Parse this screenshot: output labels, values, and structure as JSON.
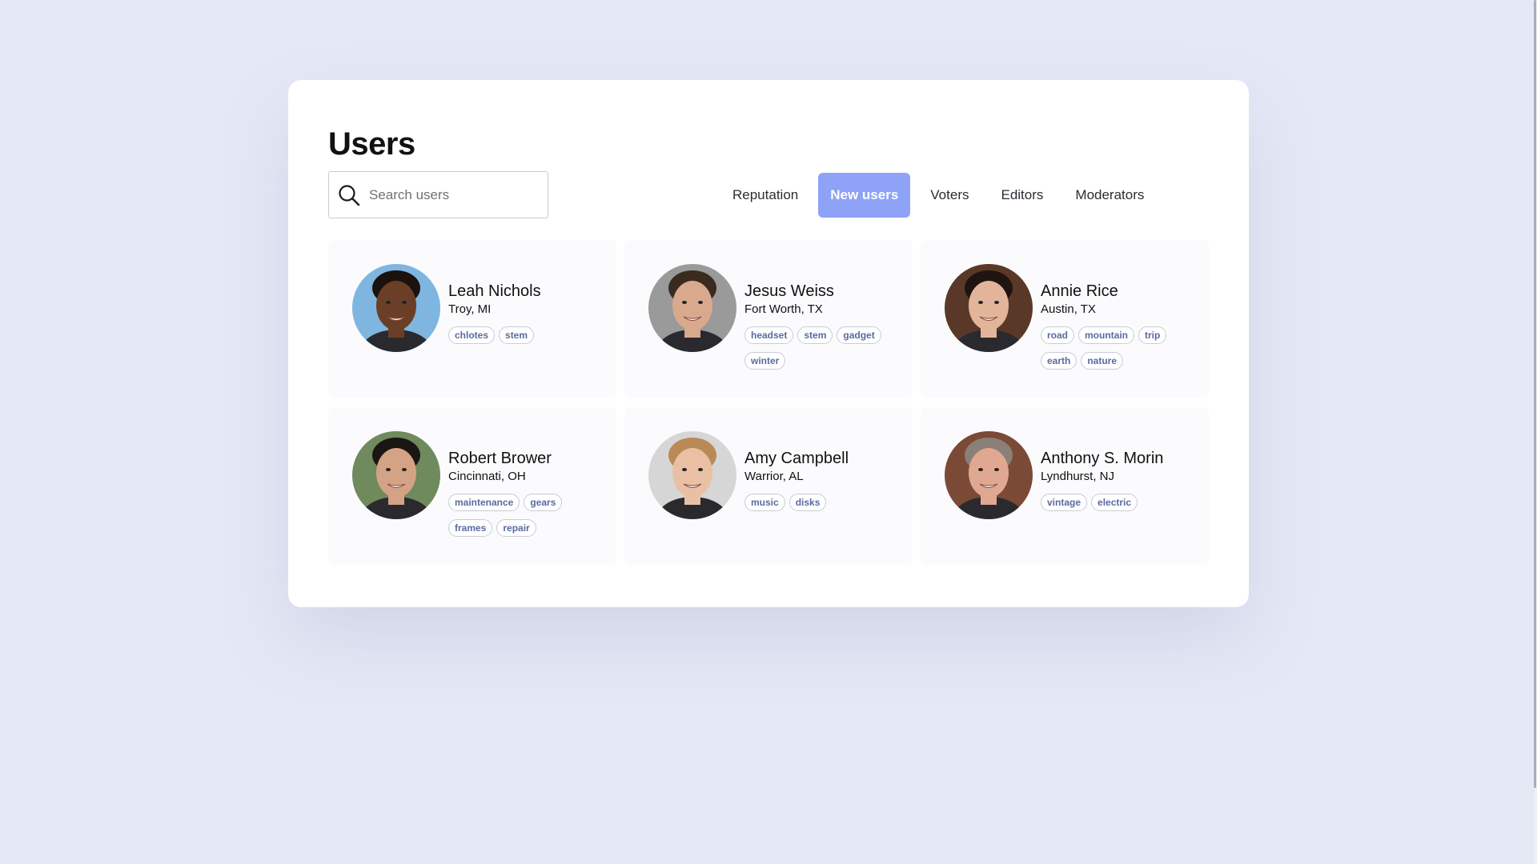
{
  "page": {
    "title": "Users"
  },
  "search": {
    "placeholder": "Search users"
  },
  "tabs": [
    {
      "label": "Reputation",
      "active": false
    },
    {
      "label": "New users",
      "active": true
    },
    {
      "label": "Voters",
      "active": false
    },
    {
      "label": "Editors",
      "active": false
    },
    {
      "label": "Moderators",
      "active": false
    }
  ],
  "users": [
    {
      "name": "Leah Nichols",
      "location": "Troy, MI",
      "tags": [
        "chlotes",
        "stem"
      ],
      "avatar_skin": "#6b3f27",
      "avatar_bg": "#7eb6e0",
      "avatar_hair": "#1b120d"
    },
    {
      "name": "Jesus Weiss",
      "location": "Fort Worth, TX",
      "tags": [
        "headset",
        "stem",
        "gadget",
        "winter"
      ],
      "avatar_skin": "#d9a98d",
      "avatar_bg": "#9a9a9a",
      "avatar_hair": "#3a2a20"
    },
    {
      "name": "Annie Rice",
      "location": "Austin, TX",
      "tags": [
        "road",
        "mountain",
        "trip",
        "earth",
        "nature"
      ],
      "avatar_skin": "#e2b59a",
      "avatar_bg": "#5a3828",
      "avatar_hair": "#1f1410"
    },
    {
      "name": "Robert Brower",
      "location": "Cincinnati, OH",
      "tags": [
        "maintenance",
        "gears",
        "frames",
        "repair"
      ],
      "avatar_skin": "#d4a284",
      "avatar_bg": "#6f8a5c",
      "avatar_hair": "#1a1614"
    },
    {
      "name": "Amy Campbell",
      "location": "Warrior, AL",
      "tags": [
        "music",
        "disks"
      ],
      "avatar_skin": "#eac0a4",
      "avatar_bg": "#d6d6d6",
      "avatar_hair": "#b98a55"
    },
    {
      "name": "Anthony S. Morin",
      "location": "Lyndhurst, NJ",
      "tags": [
        "vintage",
        "electric"
      ],
      "avatar_skin": "#e0a890",
      "avatar_bg": "#7a4a36",
      "avatar_hair": "#8a8078"
    }
  ],
  "colors": {
    "page_bg": "#e5e9f6",
    "accent": "#8ea2f8",
    "tag_text": "#5a6aa0"
  },
  "icons": {
    "search": "search-icon"
  }
}
